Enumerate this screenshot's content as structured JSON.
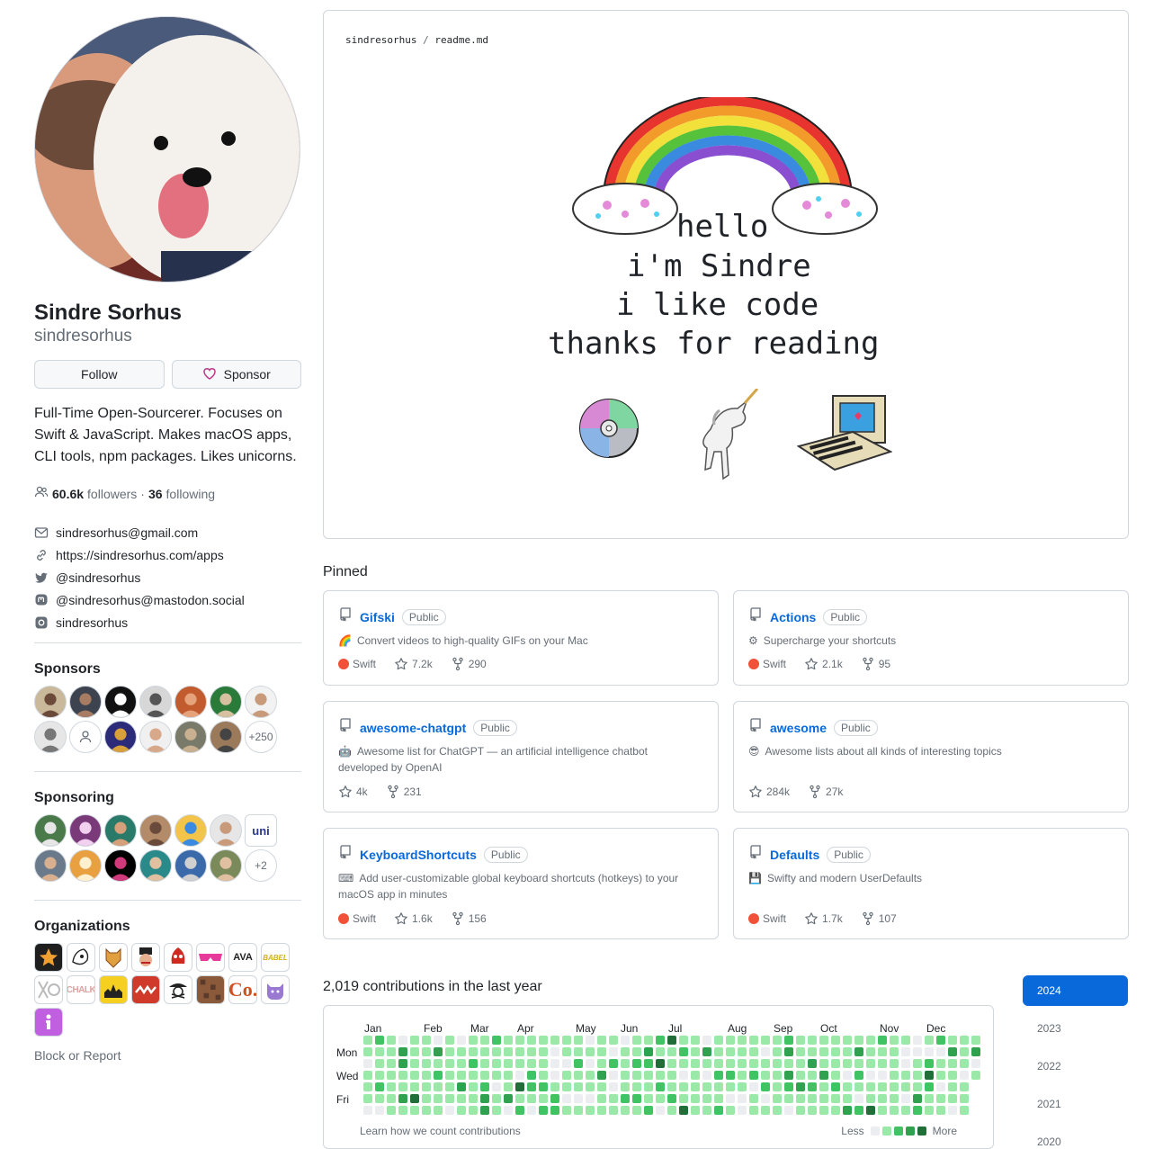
{
  "profile": {
    "display_name": "Sindre Sorhus",
    "login": "sindresorhus",
    "follow_label": "Follow",
    "sponsor_label": "Sponsor",
    "bio": "Full-Time Open-Sourcerer. Focuses on Swift & JavaScript. Makes macOS apps, CLI tools, npm packages. Likes unicorns.",
    "followers_count": "60.6k",
    "followers_label": "followers",
    "separator": "·",
    "following_count": "36",
    "following_label": "following",
    "links": {
      "email": "sindresorhus@gmail.com",
      "website": "https://sindresorhus.com/apps",
      "twitter": "@sindresorhus",
      "mastodon": "@sindresorhus@mastodon.social",
      "instagram": "sindresorhus"
    }
  },
  "sponsors": {
    "heading": "Sponsors",
    "more": "+250"
  },
  "sponsoring": {
    "heading": "Sponsoring",
    "uni_label": "uni",
    "more": "+2"
  },
  "organizations": {
    "heading": "Organizations",
    "chalk_label": "CHALK",
    "ava_label": "AVA",
    "babel_label": "BABEL",
    "co_label": "Co."
  },
  "block_report": "Block or Report",
  "readme": {
    "owner": "sindresorhus",
    "slash": "/",
    "file": "readme.md",
    "line1": "hello",
    "line2": "i'm Sindre",
    "line3": "i like code",
    "line4": "thanks for reading"
  },
  "pinned": {
    "heading": "Pinned",
    "public_label": "Public",
    "language": "Swift",
    "repos": [
      {
        "name": "Gifski",
        "emoji": "🌈",
        "description": "Convert videos to high-quality GIFs on your Mac",
        "stars": "7.2k",
        "forks": "290",
        "has_lang": true
      },
      {
        "name": "Actions",
        "emoji": "⚙",
        "description": "Supercharge your shortcuts",
        "stars": "2.1k",
        "forks": "95",
        "has_lang": true
      },
      {
        "name": "awesome-chatgpt",
        "emoji": "🤖",
        "description": "Awesome list for ChatGPT — an artificial intelligence chatbot developed by OpenAI",
        "stars": "4k",
        "forks": "231",
        "has_lang": false
      },
      {
        "name": "awesome",
        "emoji": "😎",
        "description": "Awesome lists about all kinds of interesting topics",
        "stars": "284k",
        "forks": "27k",
        "has_lang": false
      },
      {
        "name": "KeyboardShortcuts",
        "emoji": "⌨",
        "description": "Add user-customizable global keyboard shortcuts (hotkeys) to your macOS app in minutes",
        "stars": "1.6k",
        "forks": "156",
        "has_lang": true
      },
      {
        "name": "Defaults",
        "emoji": "💾",
        "description": "Swifty and modern UserDefaults",
        "stars": "1.7k",
        "forks": "107",
        "has_lang": true
      }
    ]
  },
  "contributions": {
    "heading": "2,019 contributions in the last year",
    "months": [
      "Jan",
      "Feb",
      "Mar",
      "Apr",
      "May",
      "Jun",
      "Jul",
      "Aug",
      "Sep",
      "Oct",
      "Nov",
      "Dec"
    ],
    "days": [
      "Mon",
      "Wed",
      "Fri"
    ],
    "learn": "Learn how we count contributions",
    "less": "Less",
    "more": "More",
    "levels": [
      "#ebedf0",
      "#9be9a8",
      "#40c463",
      "#30a14e",
      "#216e39"
    ]
  },
  "years": [
    "2024",
    "2023",
    "2022",
    "2021",
    "2020"
  ]
}
